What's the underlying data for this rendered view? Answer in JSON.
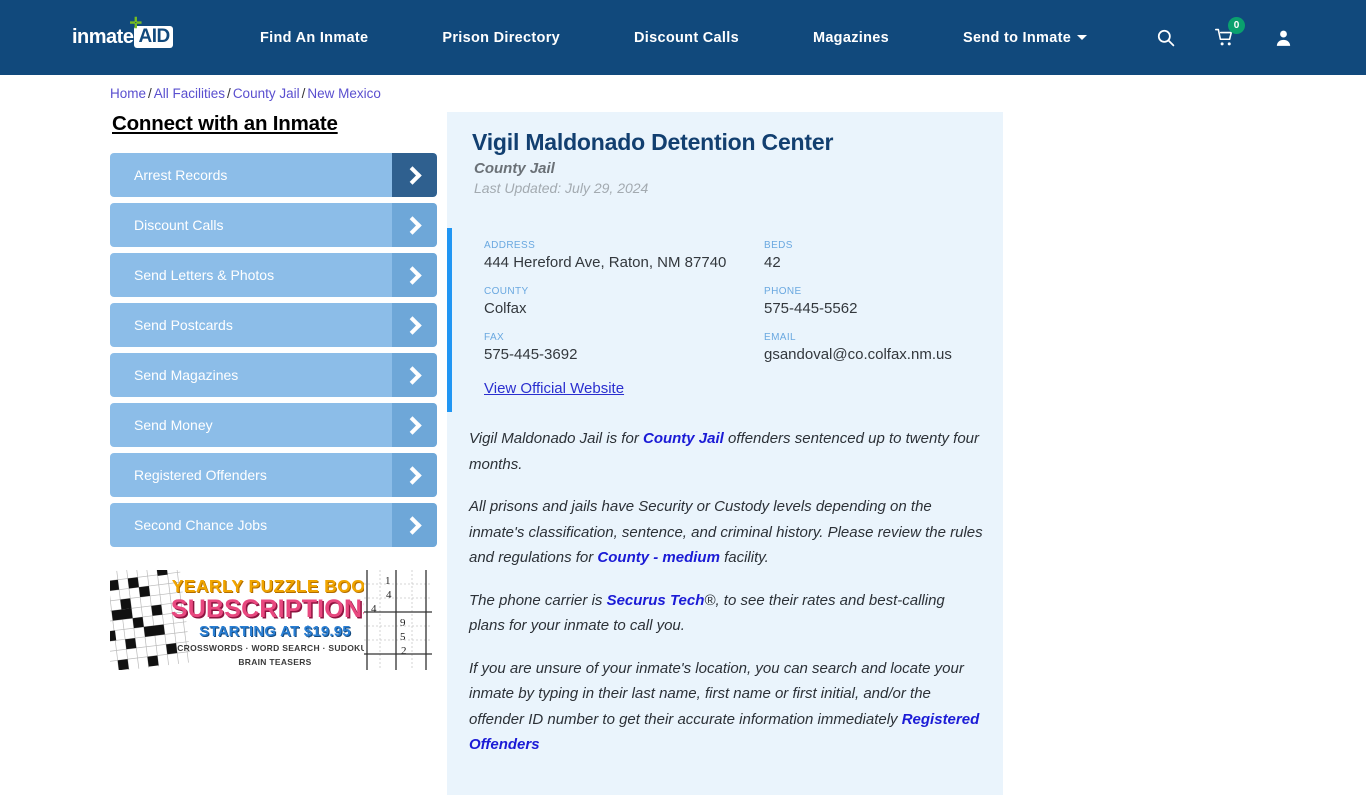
{
  "navbar": {
    "logo": {
      "word": "inmate",
      "badge": "AID",
      "plus": "✛"
    },
    "links": [
      {
        "label": "Find An Inmate"
      },
      {
        "label": "Prison Directory"
      },
      {
        "label": "Discount Calls"
      },
      {
        "label": "Magazines"
      },
      {
        "label": "Send to Inmate"
      }
    ],
    "icons": {
      "search": "search-icon",
      "cart": "cart-icon",
      "cart_badge": "0",
      "account": "user-icon"
    },
    "background_color": "#11497c"
  },
  "breadcrumb": {
    "items": [
      "Home",
      "All Facilities",
      "County Jail",
      "New Mexico"
    ],
    "separator": "/"
  },
  "sidebar": {
    "title": "Connect with an Inmate",
    "items": [
      {
        "label": "Arrest Records",
        "active": true
      },
      {
        "label": "Discount Calls",
        "active": false
      },
      {
        "label": "Send Letters & Photos",
        "active": false
      },
      {
        "label": "Send Postcards",
        "active": false
      },
      {
        "label": "Send Magazines",
        "active": false
      },
      {
        "label": "Send Money",
        "active": false
      },
      {
        "label": "Registered Offenders",
        "active": false
      },
      {
        "label": "Second Chance Jobs",
        "active": false
      }
    ],
    "button_color": "#8cbde8",
    "arrow_color": "#6ea7d8",
    "arrow_active_color": "#2f608f"
  },
  "ad": {
    "line1": "YEARLY PUZZLE BOOK",
    "line2": "SUBSCRIPTIONS",
    "line3": "STARTING AT $19.95",
    "line4": "CROSSWORDS · WORD SEARCH · SUDOKU · BRAIN TEASERS",
    "sudoku_numbers": [
      "1",
      "4",
      "4",
      "9",
      "5",
      "2"
    ]
  },
  "facility": {
    "name": "Vigil Maldonado Detention Center",
    "type": "County Jail",
    "last_updated": "Last Updated: July 29, 2024",
    "fields": [
      {
        "label": "ADDRESS",
        "value": "444 Hereford Ave, Raton, NM 87740"
      },
      {
        "label": "BEDS",
        "value": "42"
      },
      {
        "label": "COUNTY",
        "value": "Colfax"
      },
      {
        "label": "PHONE",
        "value": "575-445-5562"
      },
      {
        "label": "FAX",
        "value": "575-445-3692"
      },
      {
        "label": "EMAIL",
        "value": "gsandoval@co.colfax.nm.us"
      }
    ],
    "website_link": "View Official Website",
    "accent_color": "#2196f3",
    "card_color": "#eaf4fc"
  },
  "description": {
    "p1_a": "Vigil Maldonado Jail is for ",
    "p1_link": "County Jail",
    "p1_b": " offenders sentenced up to twenty four months.",
    "p2_a": "All prisons and jails have Security or Custody levels depending on the inmate's classification, sentence, and criminal history. Please review the rules and regulations for ",
    "p2_link": "County - medium",
    "p2_b": " facility.",
    "p3_a": "The phone carrier is ",
    "p3_link": "Securus Tech",
    "p3_b": "®, to see their rates and best-calling plans for your inmate to call you.",
    "p4_a": "If you are unsure of your inmate's location, you can search and locate your inmate by typing in their last name, first name or first initial, and/or the offender ID number to get their accurate information immediately ",
    "p4_link": "Registered Offenders"
  }
}
